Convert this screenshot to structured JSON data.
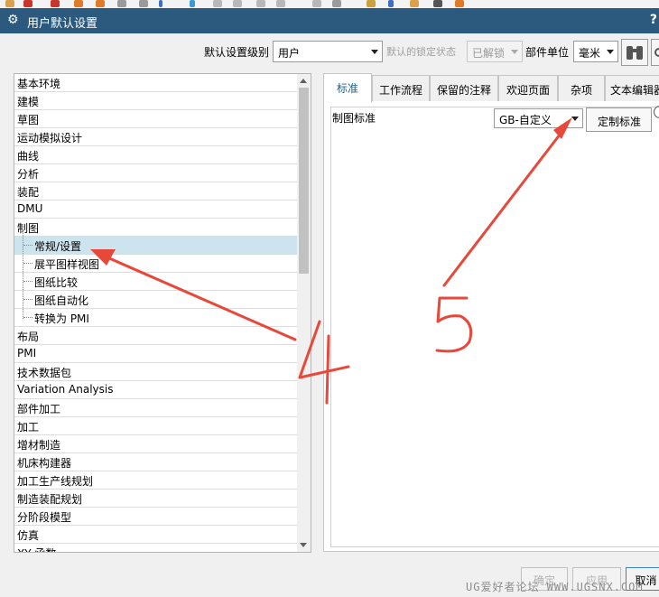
{
  "window": {
    "title": "用户默认设置",
    "help_label": "?"
  },
  "toolbar": {
    "level_label": "默认设置级别",
    "level_value": "用户",
    "lock_label": "默认的锁定状态",
    "lock_value": "已解锁",
    "unit_label": "部件单位",
    "unit_value": "毫米"
  },
  "tree": {
    "items": [
      {
        "label": "基本环境",
        "level": 0
      },
      {
        "label": "建模",
        "level": 0
      },
      {
        "label": "草图",
        "level": 0
      },
      {
        "label": "运动模拟设计",
        "level": 0
      },
      {
        "label": "曲线",
        "level": 0
      },
      {
        "label": "分析",
        "level": 0
      },
      {
        "label": "装配",
        "level": 0
      },
      {
        "label": "DMU",
        "level": 0
      },
      {
        "label": "制图",
        "level": 0
      },
      {
        "label": "常规/设置",
        "level": 1,
        "selected": true
      },
      {
        "label": "展平图样视图",
        "level": 1
      },
      {
        "label": "图纸比较",
        "level": 1
      },
      {
        "label": "图纸自动化",
        "level": 1
      },
      {
        "label": "转换为 PMI",
        "level": 1
      },
      {
        "label": "布局",
        "level": 0
      },
      {
        "label": "PMI",
        "level": 0
      },
      {
        "label": "技术数据包",
        "level": 0
      },
      {
        "label": "Variation Analysis",
        "level": 0
      },
      {
        "label": "部件加工",
        "level": 0
      },
      {
        "label": "加工",
        "level": 0
      },
      {
        "label": "增材制造",
        "level": 0
      },
      {
        "label": "机床构建器",
        "level": 0
      },
      {
        "label": "加工生产线规划",
        "level": 0
      },
      {
        "label": "制造装配规划",
        "level": 0
      },
      {
        "label": "分阶段模型",
        "level": 0
      },
      {
        "label": "仿真",
        "level": 0
      },
      {
        "label": "XY 函数",
        "level": 0
      }
    ]
  },
  "tabs": [
    "标准",
    "工作流程",
    "保留的注释",
    "欢迎页面",
    "杂项",
    "文本编辑器"
  ],
  "panel": {
    "drawing_standard_label": "制图标准",
    "drawing_standard_value": "GB-自定义",
    "customize_button": "定制标准"
  },
  "footer": {
    "ok": "确定",
    "apply": "应用",
    "cancel": "取消"
  },
  "annotations": {
    "arrow4_label": "4",
    "arrow5_label": "5",
    "color": "#e8483a"
  },
  "watermark": "UG爱好者论坛 WWW.UGSNX.COM"
}
